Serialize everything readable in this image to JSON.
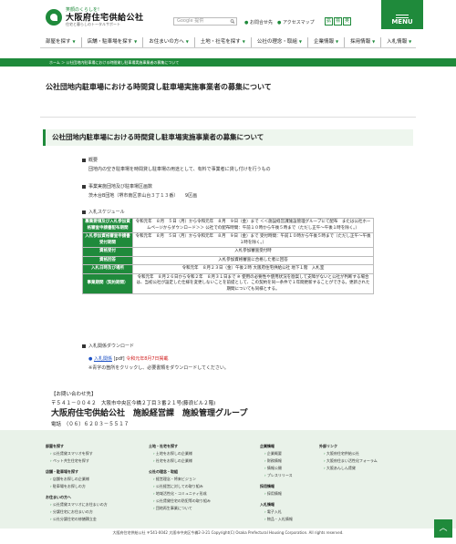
{
  "header": {
    "logo_tag": "笑顔のくらしを!",
    "logo_name": "大阪府住宅供給公社",
    "logo_sub": "住宅と暮らしのトータルサポート",
    "search_placeholder": "Google 提供",
    "util_links": [
      "お問合せ先",
      "アクセスマップ"
    ],
    "lang_buttons": [
      "拡",
      "標",
      "英"
    ],
    "menu_label": "MENU"
  },
  "gnav": [
    "部屋を探す",
    "店舗・駐車場を探す",
    "お住まいの方へ",
    "土地・社宅を探す",
    "公社の理念・取組",
    "企業情報",
    "採用情報",
    "入札情報"
  ],
  "breadcrumb": "ホーム ＞ 公社団地内駐車場における時間貸し駐車場実施事業者の募集について",
  "page_title": "公社団地内駐車場における時間貸し駐車場実施事業者の募集について",
  "section_title": "公社団地内駐車場における時間貸し駐車場実施事業者の募集について",
  "overview": {
    "heading": "概要",
    "text": "団地内の空き駐車場を時間貸し駐車場の用途として、有料で事業者に貸し付けを行うもの"
  },
  "target": {
    "heading": "事業実施団地及び駐車場区画数",
    "text": "茨木台B団地（堺市南区茶山台３丁１３番）　　9区画"
  },
  "schedule": {
    "heading": "入札スケジュール",
    "rows": [
      {
        "label": "募集要領及び入札参加資格審査申請書配布期間",
        "value": "令和元年　８月　５日（月）から令和元年　８月　９日（金）まで ＜＜施設経営課施設管理グループにて配布　または公社ホームページからダウンロード＞＞ 公社での配布時間：午前１０時から午後５時まで（ただし正午～午後１時を除く。）"
      },
      {
        "label": "入札参加資格審査申請書受付期間",
        "value": "令和元年　８月　５日（月）から令和元年　８月　９日（金）まで 受付時間：午前１０時から午後５時まで（ただし正午～午後１時を除く。）"
      },
      {
        "label": "資格受付",
        "value": "入札参加審査受付時"
      },
      {
        "label": "資格回答",
        "value": "入札参加資格審査に合格した者に回答"
      },
      {
        "label": "入札日時及び場所",
        "value": "令和元年　８月２３日（金）午後２時 大阪府住宅供給公社 地下１階　入札室"
      },
      {
        "label": "事業期間（契約期間）",
        "value": "令和元年　８月２６日から令和２年　８月３１日まで ※ 使用の必要性や使用状況を勘案して支障がないと公社が判断する場合は、当初公社が設定した仕様を変更しないことを前提として、この契約を同一条件で１年間更新することができる。更新された期間についても同様とする。"
      }
    ]
  },
  "download": {
    "heading": "入札関係ダウンロード",
    "link": "入札関係",
    "format": "[pdf]",
    "note_red": "令和元年8月7日掲載",
    "note": "※青字の箇所をクリックし、必要書類をダウンロードしてください。"
  },
  "contact": {
    "heading": "【お問い合わせ先】",
    "address": "〒５４１－００４２　大阪市中央区今橋２丁目３番２１号(藤浪ビル２階)",
    "org": "大阪府住宅供給公社　施設経営課　施設管理グループ",
    "tel": "電話　（０６）６２０３－５５１７"
  },
  "footer": {
    "columns": [
      {
        "heading": "部屋を探す",
        "items": [
          "公社賃貸スマリオを探す",
          "ペット共生住宅を探す"
        ]
      },
      {
        "heading": "店舗・駐車場を探す",
        "items": [
          "店舗をお探しの企業様",
          "駐車場をお探しの方"
        ]
      },
      {
        "heading": "お住まいの方へ",
        "items": [
          "公社賃貸スマリオにお住まいの方",
          "分譲住宅にお住まいの方",
          "公社分譲住宅の修繕積立金"
        ]
      },
      {
        "heading": "土地・社宅を探す",
        "items": [
          "土地をお探しの企業様",
          "社宅をお探しの企業様"
        ]
      },
      {
        "heading": "公社の理念・取組",
        "items": [
          "経営理念・将来ビジョン",
          "公社経営に対しての取り組み",
          "地域活性化・コミュニティ形成",
          "公社賃貸住宅の防犯等の取り組み",
          "団地再生事業について"
        ]
      },
      {
        "heading": "企業情報",
        "items": [
          "企業概要",
          "財務情報",
          "情報公開",
          "プレスリリース"
        ]
      },
      {
        "heading": "採用情報",
        "items": [
          "採用情報"
        ]
      },
      {
        "heading": "入札情報",
        "items": [
          "電子入札",
          "物品・入札情報"
        ]
      },
      {
        "heading": "外部リンク",
        "items": [
          "大阪府住宅供給公社",
          "大阪府住まい活性化フォーラム",
          "大阪あんしん賃貸"
        ]
      }
    ],
    "copyright": "大阪府住宅供給公社 〒541-0042 大阪市中央区今橋2-3-21 Copyright(C) Osaka Prefectural Housing Corporation. All rights reserved."
  },
  "colors": {
    "brand": "#1f8a3b",
    "link": "#1a4fc4",
    "alert": "#d12020"
  }
}
